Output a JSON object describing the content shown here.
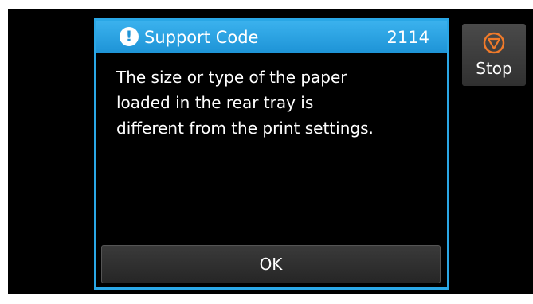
{
  "dialog": {
    "title": "Support Code",
    "code": "2114",
    "message_lines": [
      "The size or type of the paper",
      "loaded in the rear tray is",
      "different from the print settings."
    ],
    "ok_label": "OK",
    "header_color": "#1d93d6",
    "border_color": "#2aa7e6"
  },
  "stop_button": {
    "label": "Stop",
    "icon": "stop-icon",
    "icon_color": "#f07a2a"
  }
}
